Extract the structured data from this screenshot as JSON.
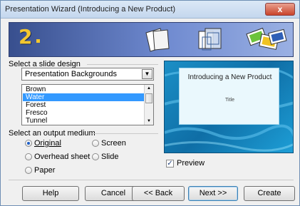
{
  "window": {
    "title": "Presentation Wizard (Introducing a New Product)",
    "close_glyph": "x"
  },
  "banner": {
    "step": "2",
    "icons": [
      "blank-pages-icon",
      "slide-frames-icon",
      "colored-cards-icon"
    ]
  },
  "design": {
    "section_label": "Select a slide design",
    "dropdown_value": "Presentation Backgrounds",
    "items": [
      {
        "label": "Brown",
        "selected": false
      },
      {
        "label": "Water",
        "selected": true
      },
      {
        "label": "Forest",
        "selected": false
      },
      {
        "label": "Fresco",
        "selected": false
      },
      {
        "label": "Tunnel",
        "selected": false
      }
    ]
  },
  "medium": {
    "section_label": "Select an output medium",
    "options": [
      {
        "label": "Original",
        "checked": true
      },
      {
        "label": "Overhead sheet",
        "checked": false
      },
      {
        "label": "Paper",
        "checked": false
      },
      {
        "label": "Screen",
        "checked": false
      },
      {
        "label": "Slide",
        "checked": false
      }
    ]
  },
  "preview": {
    "slide_title": "Introducing a New Product",
    "slide_subtitle": "Title",
    "checkbox_label": "Preview",
    "checked": true,
    "background_color": "#1b8fc6"
  },
  "buttons": {
    "help": "Help",
    "cancel": "Cancel",
    "back": "<< Back",
    "next": "Next >>",
    "create": "Create"
  },
  "colors": {
    "banner": "#384f8e",
    "step_number": "#f3c72f",
    "selection": "#3399ff"
  }
}
